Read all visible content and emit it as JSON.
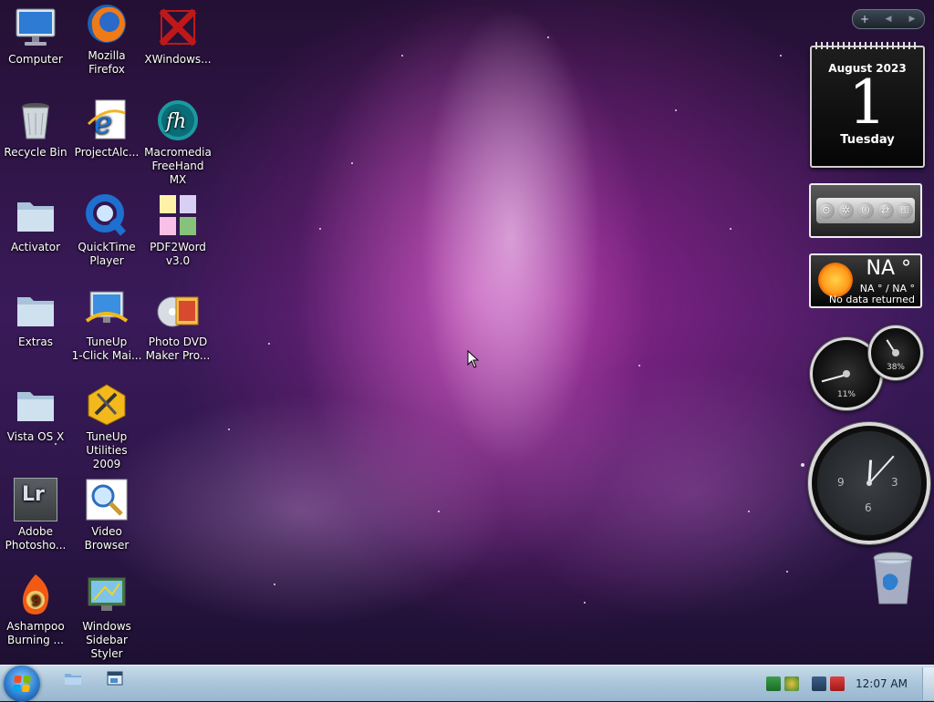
{
  "desktop": {
    "icons": [
      {
        "id": "computer",
        "label": "Computer"
      },
      {
        "id": "firefox",
        "label": "Mozilla\nFirefox"
      },
      {
        "id": "xwindows",
        "label": "XWindows..."
      },
      {
        "id": "recycle",
        "label": "Recycle Bin"
      },
      {
        "id": "projectalc",
        "label": "ProjectAlc..."
      },
      {
        "id": "freehand",
        "label": "Macromedia\nFreeHand MX"
      },
      {
        "id": "activator",
        "label": "Activator"
      },
      {
        "id": "quicktime",
        "label": "QuickTime\nPlayer"
      },
      {
        "id": "pdf2word",
        "label": "PDF2Word\nv3.0"
      },
      {
        "id": "extras",
        "label": "Extras"
      },
      {
        "id": "tuneup1click",
        "label": "TuneUp\n1-Click Mai..."
      },
      {
        "id": "photodvd",
        "label": "Photo DVD\nMaker Pro..."
      },
      {
        "id": "vistaosx",
        "label": "Vista OS X"
      },
      {
        "id": "tuneuputil",
        "label": "TuneUp\nUtilities 2009"
      },
      {
        "id": "lightroom",
        "label": "Adobe\nPhotosho..."
      },
      {
        "id": "videobrowser",
        "label": "Video\nBrowser"
      },
      {
        "id": "ashampoo",
        "label": "Ashampoo\nBurning ..."
      },
      {
        "id": "sidebarstyler",
        "label": "Windows\nSidebar Styler"
      }
    ]
  },
  "sidebar": {
    "add_glyph": "+",
    "prev_glyph": "◀",
    "next_glyph": "▶"
  },
  "calendar": {
    "month": "August 2023",
    "day": "1",
    "weekday": "Tuesday"
  },
  "weather": {
    "temp": "NA °",
    "range": "NA ° / NA °",
    "status": "No data returned"
  },
  "meters": {
    "cpu_pct": "11%",
    "cpu_value": 11,
    "mem_pct": "38%",
    "mem_value": 38
  },
  "clock": {
    "labels": {
      "nine": "9",
      "three": "3",
      "six": "6"
    },
    "time": "12:07"
  },
  "lightroom_glyph": "Lr",
  "taskbar": {
    "time": "12:07 AM"
  },
  "colors": {
    "accent": "#3b86d6",
    "taskbar": "#aac5db"
  }
}
